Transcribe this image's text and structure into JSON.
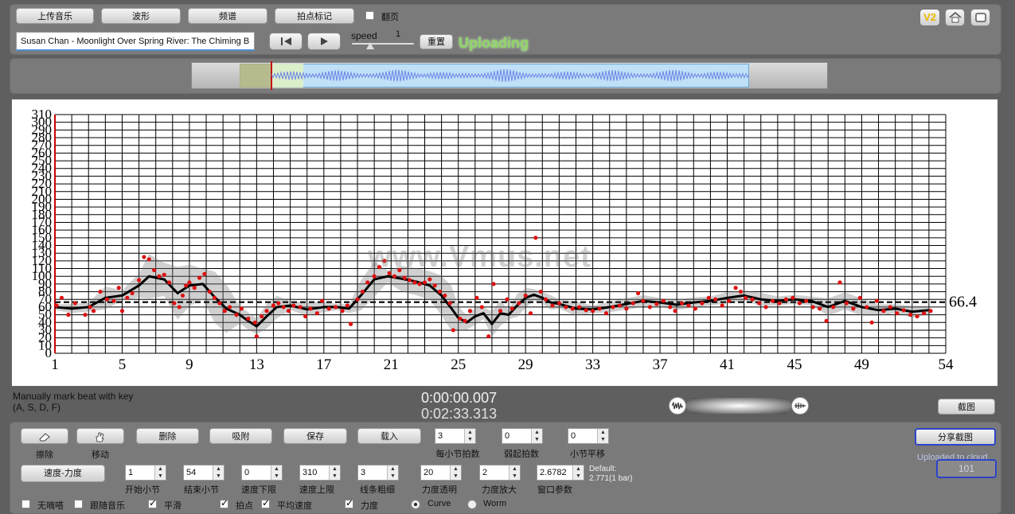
{
  "toolbar": {
    "upload_music": "上传音乐",
    "waveform": "波形",
    "spectrum": "频谱",
    "tap_marking": "拍点标记",
    "page_turn": "翻页",
    "page_turn_checked": false,
    "v2_badge": "V2"
  },
  "track": {
    "title": "Susan Chan - Moonlight Over Spring River:   The Chiming B"
  },
  "transport": {
    "speed_label": "speed",
    "speed_value": "1",
    "speed_level": 0.3,
    "reset": "重置",
    "status": "Uploading"
  },
  "timeline": {
    "selection_start_fraction": 0.075,
    "selection_end_fraction": 0.875
  },
  "watermark": "www.Vmus.net",
  "chart_data": {
    "type": "line",
    "y_ticks": [
      0,
      10,
      20,
      30,
      40,
      50,
      60,
      70,
      80,
      90,
      100,
      110,
      120,
      130,
      140,
      150,
      160,
      170,
      180,
      190,
      200,
      210,
      220,
      230,
      240,
      250,
      260,
      270,
      280,
      290,
      300,
      310
    ],
    "ylim": [
      0,
      310
    ],
    "x_ticks": [
      1,
      5,
      9,
      13,
      17,
      21,
      25,
      29,
      33,
      37,
      41,
      45,
      49,
      54
    ],
    "xlim": [
      1,
      54
    ],
    "average_value": 66.4,
    "average_label": "66.4",
    "grid": true,
    "series": [
      {
        "kind": "smoothed tempo",
        "x": [
          1,
          2,
          3,
          4,
          5,
          6,
          6.6,
          7.5,
          8.3,
          9,
          9.8,
          10.5,
          11.2,
          12,
          12.5,
          13,
          13.6,
          14.2,
          15,
          16,
          17,
          17.8,
          18.5,
          19.2,
          20,
          20.8,
          21.6,
          22.5,
          23.3,
          24,
          24.6,
          25,
          25.5,
          26,
          26.5,
          27,
          27.5,
          28,
          28.5,
          29,
          29.5,
          30,
          30.5,
          31,
          32,
          33,
          34,
          35,
          36,
          37,
          38,
          39,
          40,
          41,
          42,
          43,
          44,
          45,
          46,
          47,
          48,
          49,
          50,
          51,
          52,
          53
        ],
        "y": [
          60,
          58,
          60,
          72,
          75,
          88,
          100,
          96,
          78,
          88,
          90,
          73,
          58,
          50,
          42,
          35,
          48,
          60,
          62,
          57,
          60,
          60,
          58,
          75,
          96,
          100,
          97,
          93,
          88,
          75,
          58,
          46,
          40,
          48,
          52,
          38,
          52,
          50,
          62,
          72,
          76,
          72,
          66,
          64,
          58,
          57,
          60,
          64,
          68,
          66,
          63,
          66,
          68,
          72,
          75,
          70,
          68,
          70,
          68,
          60,
          68,
          60,
          56,
          58,
          54,
          56
        ]
      },
      {
        "kind": "beat tempo points",
        "points": [
          [
            1.1,
            62
          ],
          [
            1.4,
            72
          ],
          [
            1.8,
            50
          ],
          [
            2.2,
            65
          ],
          [
            2.8,
            50
          ],
          [
            3.1,
            60
          ],
          [
            3.3,
            55
          ],
          [
            3.7,
            80
          ],
          [
            4.1,
            70
          ],
          [
            4.5,
            68
          ],
          [
            4.8,
            85
          ],
          [
            5,
            55
          ],
          [
            5.3,
            72
          ],
          [
            5.6,
            78
          ],
          [
            6,
            95
          ],
          [
            6.3,
            125
          ],
          [
            6.6,
            122
          ],
          [
            6.9,
            108
          ],
          [
            7.2,
            100
          ],
          [
            7.5,
            102
          ],
          [
            7.8,
            92
          ],
          [
            8.1,
            65
          ],
          [
            8.4,
            60
          ],
          [
            8.6,
            75
          ],
          [
            8.8,
            88
          ],
          [
            9,
            92
          ],
          [
            9.3,
            85
          ],
          [
            9.6,
            98
          ],
          [
            9.9,
            103
          ],
          [
            10.2,
            80
          ],
          [
            10.5,
            72
          ],
          [
            10.8,
            65
          ],
          [
            11.1,
            55
          ],
          [
            11.4,
            60
          ],
          [
            11.8,
            50
          ],
          [
            12.1,
            58
          ],
          [
            12.5,
            45
          ],
          [
            12.9,
            40
          ],
          [
            13,
            22
          ],
          [
            13.3,
            48
          ],
          [
            13.6,
            55
          ],
          [
            14,
            62
          ],
          [
            14.3,
            65
          ],
          [
            14.6,
            60
          ],
          [
            14.9,
            55
          ],
          [
            15.2,
            62
          ],
          [
            15.6,
            60
          ],
          [
            15.9,
            48
          ],
          [
            16.2,
            58
          ],
          [
            16.6,
            52
          ],
          [
            16.9,
            68
          ],
          [
            17.3,
            58
          ],
          [
            17.7,
            60
          ],
          [
            18.1,
            55
          ],
          [
            18.4,
            62
          ],
          [
            18.6,
            38
          ],
          [
            19,
            70
          ],
          [
            19.3,
            80
          ],
          [
            19.6,
            92
          ],
          [
            20,
            100
          ],
          [
            20.3,
            112
          ],
          [
            20.6,
            120
          ],
          [
            20.9,
            104
          ],
          [
            21.2,
            100
          ],
          [
            21.5,
            108
          ],
          [
            21.8,
            98
          ],
          [
            22.1,
            95
          ],
          [
            22.4,
            92
          ],
          [
            22.7,
            90
          ],
          [
            23,
            92
          ],
          [
            23.3,
            96
          ],
          [
            23.6,
            88
          ],
          [
            23.9,
            80
          ],
          [
            24.2,
            75
          ],
          [
            24.5,
            65
          ],
          [
            24.7,
            30
          ],
          [
            25.1,
            45
          ],
          [
            25.4,
            42
          ],
          [
            25.7,
            55
          ],
          [
            26.1,
            72
          ],
          [
            26.4,
            60
          ],
          [
            26.8,
            22
          ],
          [
            27.1,
            90
          ],
          [
            27.5,
            55
          ],
          [
            27.9,
            70
          ],
          [
            28.2,
            58
          ],
          [
            28.6,
            65
          ],
          [
            29,
            75
          ],
          [
            29.3,
            52
          ],
          [
            29.6,
            150
          ],
          [
            29.9,
            80
          ],
          [
            30.2,
            70
          ],
          [
            30.6,
            62
          ],
          [
            31,
            65
          ],
          [
            31.4,
            60
          ],
          [
            31.8,
            58
          ],
          [
            32.2,
            60
          ],
          [
            32.6,
            56
          ],
          [
            33,
            55
          ],
          [
            33.4,
            58
          ],
          [
            33.8,
            52
          ],
          [
            34.2,
            60
          ],
          [
            34.6,
            62
          ],
          [
            35,
            58
          ],
          [
            35.4,
            65
          ],
          [
            35.7,
            78
          ],
          [
            36,
            68
          ],
          [
            36.4,
            60
          ],
          [
            36.8,
            64
          ],
          [
            37.2,
            68
          ],
          [
            37.6,
            60
          ],
          [
            37.9,
            55
          ],
          [
            38.3,
            65
          ],
          [
            38.7,
            62
          ],
          [
            39.1,
            58
          ],
          [
            39.5,
            65
          ],
          [
            39.9,
            72
          ],
          [
            40.3,
            70
          ],
          [
            40.7,
            62
          ],
          [
            41.1,
            68
          ],
          [
            41.5,
            85
          ],
          [
            41.8,
            80
          ],
          [
            42.1,
            72
          ],
          [
            42.5,
            70
          ],
          [
            42.9,
            65
          ],
          [
            43.3,
            60
          ],
          [
            43.7,
            68
          ],
          [
            44.1,
            65
          ],
          [
            44.5,
            70
          ],
          [
            44.9,
            72
          ],
          [
            45.3,
            65
          ],
          [
            45.7,
            68
          ],
          [
            46.1,
            60
          ],
          [
            46.5,
            58
          ],
          [
            46.9,
            42
          ],
          [
            47.3,
            60
          ],
          [
            47.7,
            92
          ],
          [
            48.1,
            65
          ],
          [
            48.5,
            58
          ],
          [
            48.9,
            72
          ],
          [
            49.3,
            60
          ],
          [
            49.6,
            40
          ],
          [
            49.9,
            68
          ],
          [
            50.3,
            55
          ],
          [
            50.7,
            60
          ],
          [
            51.1,
            52
          ],
          [
            51.5,
            56
          ],
          [
            51.9,
            50
          ],
          [
            52.3,
            48
          ],
          [
            52.7,
            52
          ],
          [
            53.1,
            55
          ]
        ]
      }
    ]
  },
  "time": {
    "current": "0:00:00.007",
    "total": "0:02:33.313"
  },
  "hint": {
    "line1": "Manually mark beat with key",
    "line2": "(A, S, D, F)"
  },
  "screenshot_button": "截图",
  "share_screenshot": "分享截图",
  "uploaded_to_cloud": "Uploaded to cloud",
  "cloud_count": "101",
  "edit": {
    "erase": "擦除",
    "move": "移动",
    "delete": "删除",
    "snap": "吸附",
    "save": "保存",
    "load": "载入"
  },
  "params": {
    "beats_per_bar": {
      "label": "每小节拍数",
      "value": "3"
    },
    "pickup_beats": {
      "label": "弱起拍数",
      "value": "0"
    },
    "bar_shift": {
      "label": "小节平移",
      "value": "0"
    },
    "start_bar": {
      "label": "开始小节",
      "value": "1"
    },
    "end_bar": {
      "label": "结束小节",
      "value": "54"
    },
    "tempo_min": {
      "label": "速度下限",
      "value": "0"
    },
    "tempo_max": {
      "label": "速度上限",
      "value": "310"
    },
    "line_width": {
      "label": "线条粗细",
      "value": "3"
    },
    "dynamics_alpha": {
      "label": "力度透明",
      "value": "20"
    },
    "dynamics_scale": {
      "label": "力度放大",
      "value": "2"
    },
    "window_param": {
      "label": "窗口参数",
      "value": "2.6782"
    },
    "default_line1": "Default:",
    "default_line2": "2.771(1 bar)"
  },
  "mode_button": "速度-力度",
  "options": {
    "no_click": {
      "label": "无嘀嗒",
      "checked": false
    },
    "follow_music": {
      "label": "跟随音乐",
      "checked": false
    },
    "smooth": {
      "label": "平滑",
      "checked": true
    },
    "beat_points": {
      "label": "拍点",
      "checked": true
    },
    "average_tempo": {
      "label": "平均速度",
      "checked": true
    },
    "dynamics": {
      "label": "力度",
      "checked": true
    },
    "curve": {
      "label": "Curve",
      "selected": true
    },
    "worm": {
      "label": "Worm",
      "selected": false
    }
  },
  "colors": {
    "status_green": "#8fd46a",
    "point_red": "#dd1111",
    "selection_blue": "#bfe0f7",
    "waveform_blue": "#6f86e6",
    "share_border": "#2b44c9"
  }
}
